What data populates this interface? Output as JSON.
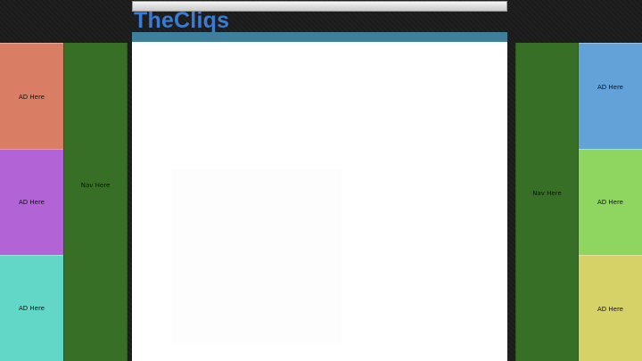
{
  "header": {
    "site_title": "TheCliqs"
  },
  "left_column": {
    "ads": [
      {
        "label": "AD Here",
        "color": "#d97e64"
      },
      {
        "label": "AD Here",
        "color": "#b263d6"
      },
      {
        "label": "AD Here",
        "color": "#62d7c8"
      }
    ],
    "nav": {
      "label": "Nav Here",
      "color": "#386f26"
    }
  },
  "right_column": {
    "nav": {
      "label": "Nav Here",
      "color": "#386f26"
    },
    "ads": [
      {
        "label": "AD Here",
        "color": "#63a2d9"
      },
      {
        "label": "AD Here",
        "color": "#8ed65f"
      },
      {
        "label": "AD Here",
        "color": "#d6d267"
      }
    ]
  },
  "colors": {
    "page_background": "#1c1c1c",
    "title_text": "#3a7bd5",
    "title_bar": "#3e7f9c",
    "content_background": "#ffffff"
  }
}
